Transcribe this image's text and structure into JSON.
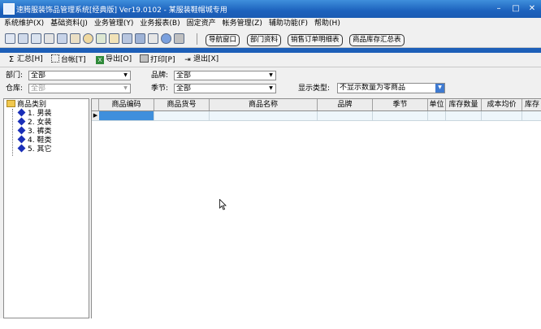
{
  "window": {
    "title": "速腾服装饰品管理系统[经典版] Ver19.0102 - 某服装鞋帽城专用"
  },
  "menu": [
    "系统维护(X)",
    "基础资料(J)",
    "业务管理(Y)",
    "业务报表(B)",
    "固定资产",
    "帐务管理(Z)",
    "辅助功能(F)",
    "帮助(H)"
  ],
  "toolbar_buttons": [
    "导航窗口",
    "部门资料",
    "销售订单明细表",
    "商品库存汇总表"
  ],
  "actions": {
    "summary": "汇总[H]",
    "ledger": "台帐[T]",
    "export": "导出[O]",
    "print": "打印[P]",
    "exit": "退出[X]"
  },
  "filters": {
    "dept_label": "部门:",
    "dept_value": "全部",
    "brand_label": "品牌:",
    "brand_value": "全部",
    "warehouse_label": "仓库:",
    "warehouse_value": "全部",
    "season_label": "季节:",
    "season_value": "全部",
    "display_label": "显示类型:",
    "display_value": "不显示数量为零商品"
  },
  "tree": {
    "root": "商品类别",
    "items": [
      "1. 男装",
      "2. 女装",
      "3. 裤类",
      "4. 鞋类",
      "5. 其它"
    ]
  },
  "grid": {
    "columns": [
      "商品编码",
      "商品货号",
      "商品名称",
      "品牌",
      "季节",
      "单位",
      "库存数量",
      "成本均价",
      "库存"
    ]
  },
  "colors": {
    "titlebar": "#1d62bd",
    "accent_bar": "#1d5fb8",
    "tree_icon": "#1a2fb8",
    "row_selected": "#3f8fdc"
  }
}
